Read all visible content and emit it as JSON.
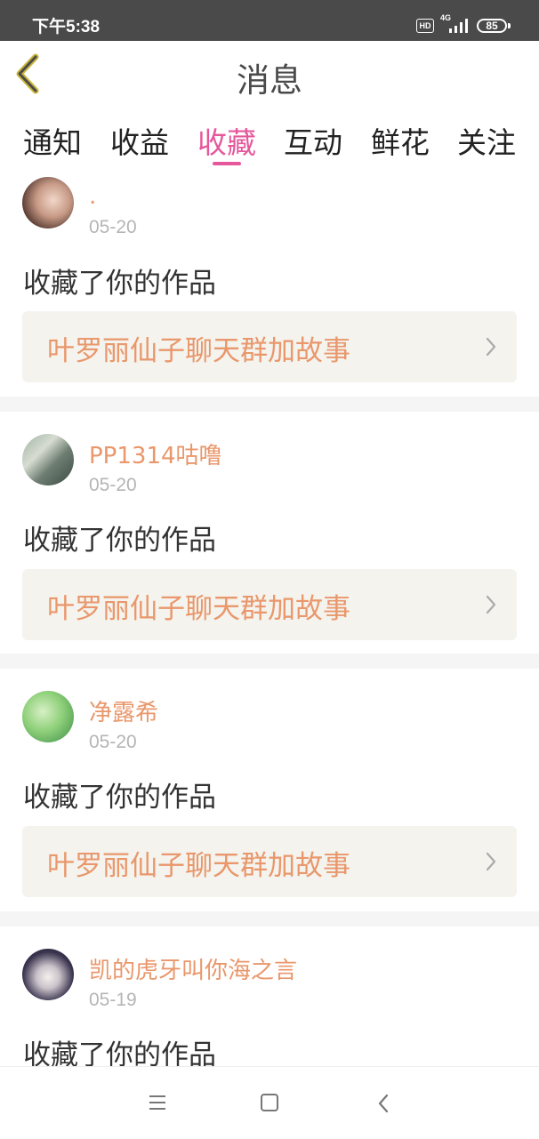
{
  "status_bar": {
    "time": "下午5:38",
    "hd": "HD",
    "network": "4G",
    "battery": "85"
  },
  "header": {
    "title": "消息"
  },
  "tabs": [
    {
      "label": "通知"
    },
    {
      "label": "收益"
    },
    {
      "label": "收藏",
      "active": true
    },
    {
      "label": "互动"
    },
    {
      "label": "鲜花"
    },
    {
      "label": "关注"
    }
  ],
  "messages": [
    {
      "username": ".",
      "date": "05-20",
      "action": "收藏了你的作品",
      "work_title": "叶罗丽仙子聊天群加故事"
    },
    {
      "username": "PP1314咕噜",
      "date": "05-20",
      "action": "收藏了你的作品",
      "work_title": "叶罗丽仙子聊天群加故事"
    },
    {
      "username": "净露希",
      "date": "05-20",
      "action": "收藏了你的作品",
      "work_title": "叶罗丽仙子聊天群加故事"
    },
    {
      "username": "凯的虎牙叫你海之言",
      "date": "05-19",
      "action": "收藏了你的作品",
      "work_title": ""
    }
  ],
  "colors": {
    "accent": "#e5589b",
    "username": "#e9976b",
    "date": "#b5b5b5"
  },
  "icons": {
    "back": "chevron-left-icon",
    "work_link": "chevron-right-icon",
    "nav_menu": "menu-icon",
    "nav_home": "home-square-icon",
    "nav_back": "back-arrow-icon"
  }
}
